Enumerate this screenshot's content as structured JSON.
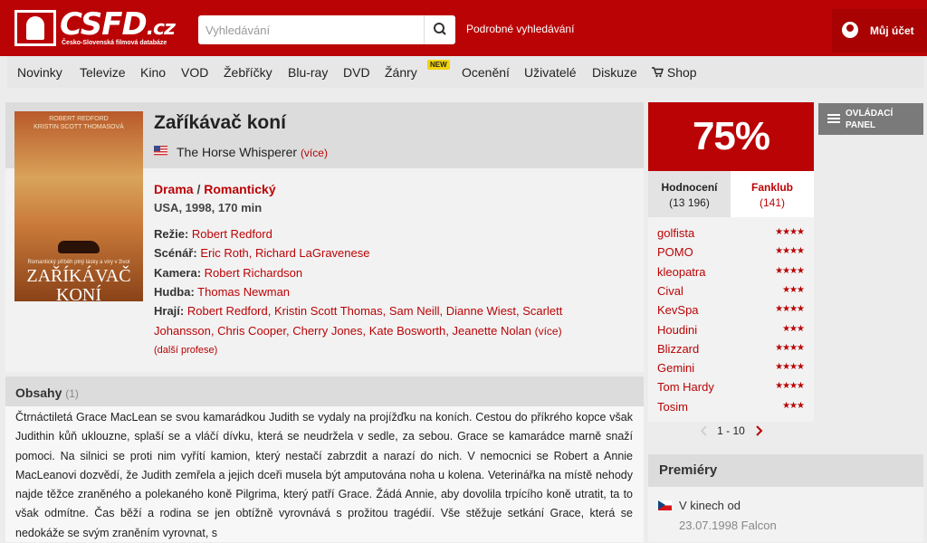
{
  "header": {
    "logo_text": "CSFD",
    "logo_tld": ".cz",
    "logo_subtitle": "Česko-Slovenská filmová databáze",
    "search_placeholder": "Vyhledávání",
    "advanced_search": "Podrobné vyhledávání",
    "account": "Můj účet"
  },
  "nav": {
    "items": [
      "Novinky",
      "Televize",
      "Kino",
      "VOD",
      "Žebříčky",
      "Blu-ray",
      "DVD",
      "Žánry",
      "Ocenění",
      "Uživatelé",
      "Diskuze",
      "Shop"
    ],
    "new_badge": "NEW"
  },
  "film": {
    "title": "Zaříkávač koní",
    "original_title": "The Horse Whisperer",
    "more": "(více)",
    "genres": [
      "Drama",
      "Romantický"
    ],
    "genre_sep": " / ",
    "origin": "USA, 1998, 170 min",
    "poster": {
      "top_text": "ROBERT REDFORD\nKRISTIN SCOTT THOMASOVÁ",
      "tagline": "Romantický příběh plný lásky a víry v život",
      "title_line1": "ZAŘÍKÁVAČ",
      "title_line2": "KONÍ"
    },
    "crew": [
      {
        "label": "Režie:",
        "people": "Robert Redford"
      },
      {
        "label": "Scénář:",
        "people": "Eric Roth, Richard LaGravenese"
      },
      {
        "label": "Kamera:",
        "people": "Robert Richardson"
      },
      {
        "label": "Hudba:",
        "people": "Thomas Newman"
      },
      {
        "label": "Hrají:",
        "people": "Robert Redford, Kristin Scott Thomas, Sam Neill, Dianne Wiest, Scarlett"
      }
    ],
    "cast_line2": "Johansson, Chris Cooper, Cherry Jones, Kate Bosworth, Jeanette Nolan",
    "cast_more": "(více)",
    "other_professions": "(další profese)"
  },
  "plot": {
    "title": "Obsahy",
    "count": "(1)",
    "text": "Čtrnáctiletá Grace MacLean se svou kamarádkou Judith se vydaly na projížďku na koních. Cestou do příkrého kopce však Judithin kůň uklouzne, splaší se a vláčí dívku, která se neudržela v sedle, za sebou. Grace se kamarádce marně snaží pomoci. Na silnici se proti nim vyřítí kamion, který nestačí zabrzdit a narazí do nich. V nemocnici se Robert a Annie MacLeanovi dozvědí, že Judith zemřela a jejich dceři musela být amputována noha u kolena. Veterinářka na místě nehody najde těžce zraněného a polekaného koně Pilgrima, který patří Grace. Žádá Annie, aby dovolila trpícího koně utratit, ta to však odmítne. Čas běží a rodina se jen obtížně vyrovnává s prožitou tragédií. Vše stěžuje setkání Grace, která se nedokáže se svým zraněním vyrovnat, s"
  },
  "rating": {
    "percent": "75%",
    "tabs": [
      {
        "label": "Hodnocení",
        "count": "(13 196)"
      },
      {
        "label": "Fanklub",
        "count": "(141)"
      }
    ],
    "users": [
      {
        "name": "golfista",
        "stars": 4
      },
      {
        "name": "POMO",
        "stars": 4
      },
      {
        "name": "kleopatra",
        "stars": 4
      },
      {
        "name": "Cival",
        "stars": 3
      },
      {
        "name": "KevSpa",
        "stars": 4
      },
      {
        "name": "Houdini",
        "stars": 3
      },
      {
        "name": "Blizzard",
        "stars": 4
      },
      {
        "name": "Gemini",
        "stars": 4
      },
      {
        "name": "Tom Hardy",
        "stars": 4
      },
      {
        "name": "Tosim",
        "stars": 3
      }
    ],
    "pager": "1 - 10"
  },
  "control_panel": {
    "label": "OVLÁDACÍ PANEL"
  },
  "premieres": {
    "title": "Premiéry",
    "cinema_label": "V kinech od",
    "date": "23.07.1998 Falcon"
  },
  "colors": {
    "brand": "#ba0305",
    "panel_grey": "#7a7a7a"
  }
}
